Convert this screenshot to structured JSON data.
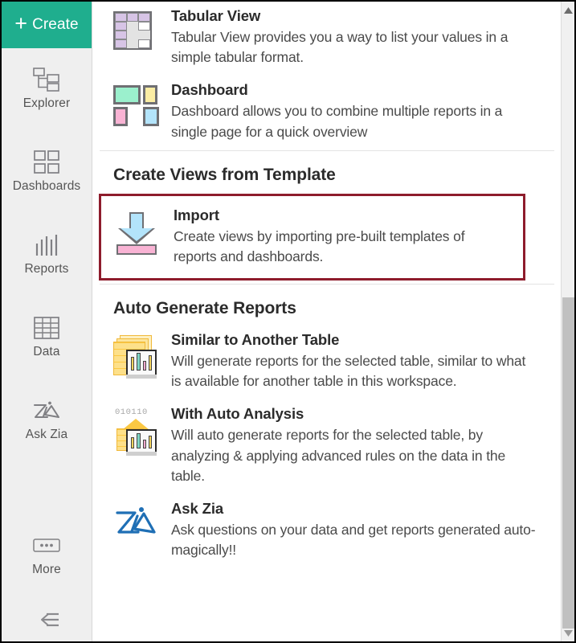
{
  "sidebar": {
    "create_button": {
      "label": "Create",
      "icon": "plus-icon",
      "color": "#1fae8e"
    },
    "items": [
      {
        "label": "Explorer",
        "icon": "explorer-tree-icon"
      },
      {
        "label": "Dashboards",
        "icon": "dashboards-grid-icon"
      },
      {
        "label": "Reports",
        "icon": "reports-bars-icon"
      },
      {
        "label": "Data",
        "icon": "data-table-icon"
      },
      {
        "label": "Ask Zia",
        "icon": "ask-zia-icon"
      },
      {
        "label": "More",
        "icon": "more-ellipsis-icon"
      }
    ],
    "collapse": {
      "icon": "collapse-panel-icon"
    }
  },
  "main": {
    "top_items": [
      {
        "title": "Tabular View",
        "description": "Tabular View provides you a way to list your values in a simple tabular format.",
        "icon": "tabular-view-icon"
      },
      {
        "title": "Dashboard",
        "description": "Dashboard allows you to combine multiple reports in a single page for a quick overview",
        "icon": "dashboard-icon"
      }
    ],
    "template_section": {
      "heading": "Create Views from Template",
      "highlight_color": "#8e1c2c",
      "items": [
        {
          "title": "Import",
          "description": "Create views by importing pre-built templates of reports and dashboards.",
          "icon": "import-download-icon"
        }
      ]
    },
    "auto_section": {
      "heading": "Auto Generate Reports",
      "items": [
        {
          "title": "Similar to Another Table",
          "description": "Will generate reports for the selected table, similar to what is available for another table in this workspace.",
          "icon": "similar-table-chart-icon"
        },
        {
          "title": "With Auto Analysis",
          "description": "Will auto generate reports for the selected table, by analyzing & applying advanced rules on the data in the table.",
          "icon": "auto-analysis-icon",
          "icon_bits": "010110"
        },
        {
          "title": "Ask Zia",
          "description": "Ask questions on your data and get reports generated auto-magically!!",
          "icon": "ask-zia-logo-icon"
        }
      ]
    }
  },
  "scrollbar": {
    "up_icon": "chevron-up-icon",
    "down_icon": "chevron-down-icon",
    "thumb": "scroll-thumb"
  }
}
